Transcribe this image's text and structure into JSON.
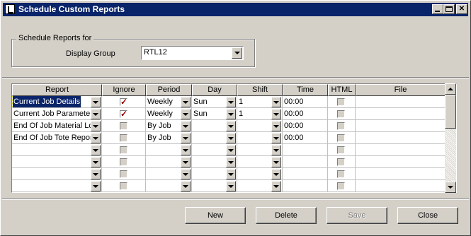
{
  "window": {
    "title": "Schedule Custom Reports"
  },
  "schedule_group": {
    "legend": "Schedule Reports for",
    "display_group_label": "Display Group",
    "display_group_value": "RTL12"
  },
  "grid": {
    "columns": [
      "Report",
      "Ignore",
      "Period",
      "Day",
      "Shift",
      "Time",
      "HTML",
      "File"
    ],
    "rows": [
      {
        "report": "Current Job Details",
        "ignore": true,
        "period": "Weekly",
        "day": "Sun",
        "shift": "1",
        "time": "00:00",
        "html": false,
        "file": ""
      },
      {
        "report": "Current Job Parameter",
        "ignore": true,
        "period": "Weekly",
        "day": "Sun",
        "shift": "1",
        "time": "00:00",
        "html": false,
        "file": ""
      },
      {
        "report": "End Of Job Material Lo",
        "ignore": false,
        "period": "By Job",
        "day": "",
        "shift": "",
        "time": "00:00",
        "html": false,
        "file": ""
      },
      {
        "report": "End Of Job Tote Repor",
        "ignore": false,
        "period": "By Job",
        "day": "",
        "shift": "",
        "time": "00:00",
        "html": false,
        "file": ""
      },
      {
        "report": "",
        "ignore": false,
        "period": "",
        "day": "",
        "shift": "",
        "time": "",
        "html": false,
        "file": ""
      },
      {
        "report": "",
        "ignore": false,
        "period": "",
        "day": "",
        "shift": "",
        "time": "",
        "html": false,
        "file": ""
      },
      {
        "report": "",
        "ignore": false,
        "period": "",
        "day": "",
        "shift": "",
        "time": "",
        "html": false,
        "file": ""
      },
      {
        "report": "",
        "ignore": false,
        "period": "",
        "day": "",
        "shift": "",
        "time": "",
        "html": false,
        "file": ""
      }
    ]
  },
  "buttons": {
    "new": "New",
    "delete": "Delete",
    "save": "Save",
    "close": "Close"
  }
}
